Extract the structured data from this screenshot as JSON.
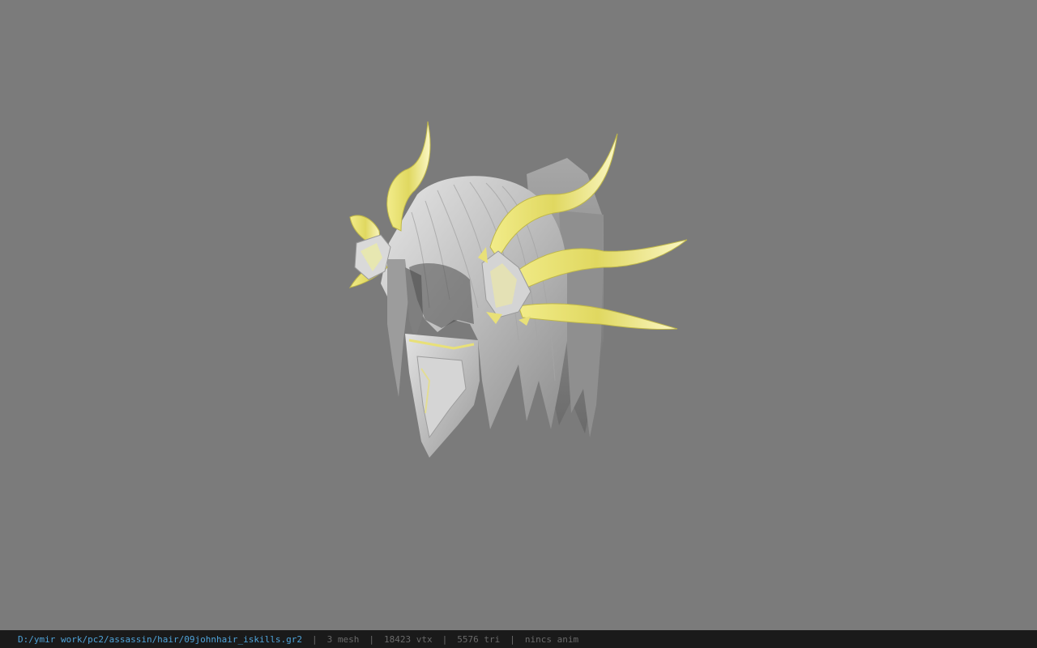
{
  "viewport": {
    "background_color": "#7b7b7b",
    "model_name": "hair-model-with-horns",
    "hair_color": "#c9c9c9",
    "horn_color": "#e8e078"
  },
  "status_bar": {
    "file_path": "D:/ymir work/pc2/assassin/hair/09johnhair_iskills.gr2",
    "separator": "|",
    "mesh_count": "3 mesh",
    "vertex_count": "18423 vtx",
    "triangle_count": "5576 tri",
    "anim_status": "nincs anim",
    "path_color": "#4fa3d9",
    "text_color": "#6a6a6a"
  }
}
